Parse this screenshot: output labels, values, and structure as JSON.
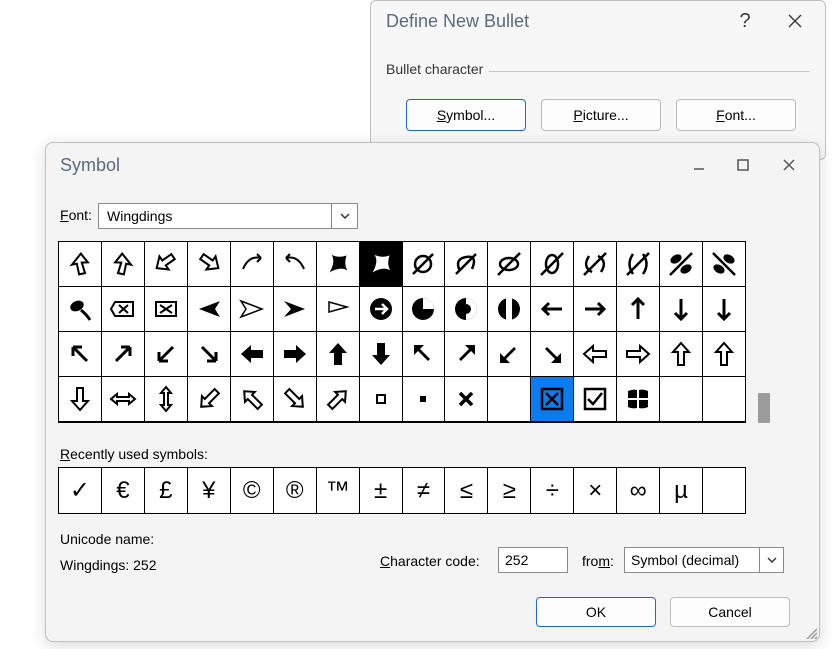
{
  "dnb": {
    "title": "Define New Bullet",
    "group_label": "Bullet character",
    "symbol_btn": "Symbol...",
    "picture_btn": "Picture...",
    "font_btn": "Font..."
  },
  "sym": {
    "title": "Symbol",
    "font_label": "Font:",
    "font_value": "Wingdings",
    "recent_label": "Recently used symbols:",
    "unicode_label": "Unicode name:",
    "unicode_value": "Wingdings: 252",
    "cc_label": "Character code:",
    "cc_value": "252",
    "from_label": "from:",
    "from_value": "Symbol (decimal)",
    "ok": "OK",
    "cancel": "Cancel",
    "selected_row": 3,
    "selected_col": 11,
    "grid_symbols_description": "Wingdings font glyphs rows (16 cols x 4 rows visible): row0 arrows/ribbons outline, row1 mixed arrows bold/outline, row2 bold arrows 8-dir + outline, row3 outline arrows, squares, check box, windows logo, trailing blanks",
    "recent_symbols": [
      "✓",
      "€",
      "£",
      "¥",
      "©",
      "®",
      "™",
      "±",
      "≠",
      "≤",
      "≥",
      "÷",
      "×",
      "∞",
      "µ"
    ]
  }
}
